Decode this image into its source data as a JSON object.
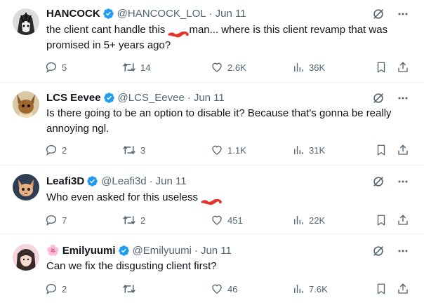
{
  "colors": {
    "verified": "#1d9bf0",
    "icon": "#536471",
    "text": "#0f1419",
    "redaction": "#e5332a"
  },
  "icons": {
    "verified": "verified-badge-icon",
    "grok": "slash-circle-icon",
    "more": "more-dots-icon",
    "reply": "reply-bubble-icon",
    "retweet": "retweet-icon",
    "like": "heart-icon",
    "views": "bar-chart-icon",
    "bookmark": "bookmark-icon",
    "share": "share-upload-icon"
  },
  "tweets": [
    {
      "name": "HANCOCK",
      "handle": "@HANCOCK_LOL",
      "separator": "·",
      "date": "Jun 11",
      "text_before": "the client cant handle this ",
      "text_after": "man... where is this client revamp that was promised in 5+ years ago?",
      "replies": "5",
      "retweets": "14",
      "likes": "2.6K",
      "views": "36K"
    },
    {
      "name": "LCS Eevee",
      "handle": "@LCS_Eevee",
      "separator": "·",
      "date": "Jun 11",
      "text_before": "Is there going to be an option to disable it? Because that's gonna be really annoying ngl.",
      "text_after": "",
      "replies": "2",
      "retweets": "3",
      "likes": "1.1K",
      "views": "31K"
    },
    {
      "name": "Leafi3D",
      "handle": "@Leafi3d",
      "separator": "·",
      "date": "Jun 11",
      "text_before": "Who even asked for this useless ",
      "text_after": "",
      "replies": "7",
      "retweets": "2",
      "likes": "451",
      "views": "22K"
    },
    {
      "name": "Emilyuumi",
      "name_prefix": "🌸",
      "handle": "@Emilyuumi",
      "separator": "·",
      "date": "Jun 11",
      "text_before": "Can we fix the disgusting client first?",
      "text_after": "",
      "replies": "2",
      "retweets": "",
      "likes": "46",
      "views": "7.6K"
    }
  ]
}
